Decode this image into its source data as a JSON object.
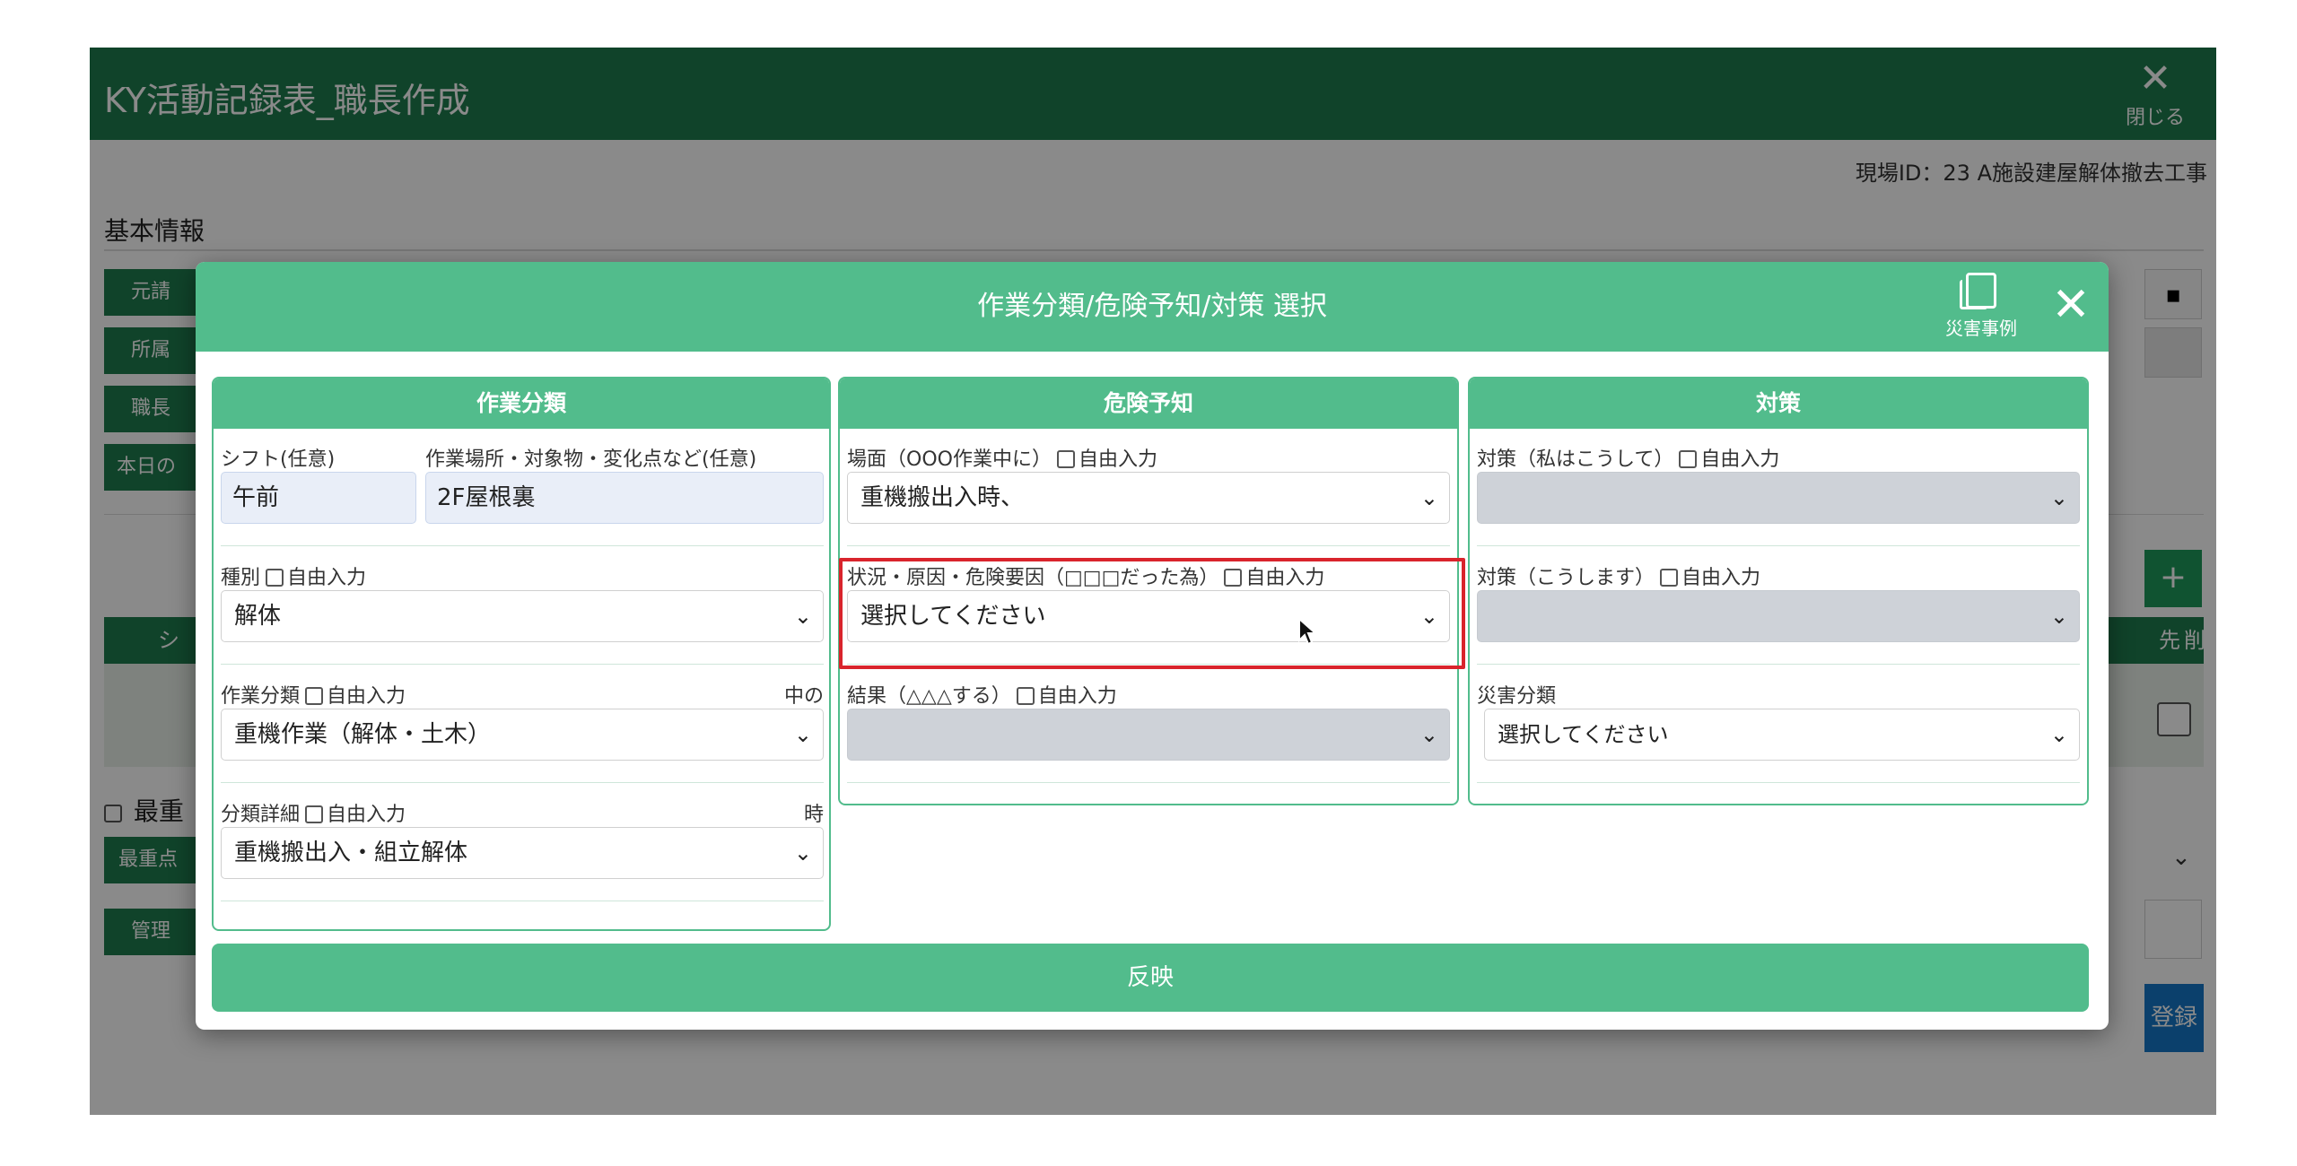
{
  "app": {
    "title": "KY活動記録表_職長作成",
    "close_label": "閉じる",
    "site_id": "現場ID：23 A施設建屋解体撤去工事",
    "section_title": "基本情報",
    "bg_labels": [
      "元請",
      "所属",
      "職長",
      "本日の"
    ],
    "table_head_first": "シ",
    "table_head_col_a": "先",
    "table_head_col_b": "削",
    "priority_label": "最重",
    "priority_field_label": "最重点",
    "manager_label": "管理",
    "register_label": "登録",
    "plus_label": "+"
  },
  "modal": {
    "title": "作業分類/危険予知/対策 選択",
    "disaster_cases_label": "災害事例",
    "close_glyph": "✕",
    "reflect_label": "反映",
    "columns": {
      "work": {
        "header": "作業分類",
        "shift_label": "シフト(任意)",
        "shift_value": "午前",
        "place_label": "作業場所・対象物・変化点など(任意)",
        "place_value": "2F屋根裏",
        "type_label": "種別",
        "type_value": "解体",
        "category_label": "作業分類",
        "category_value": "重機作業（解体・土木）",
        "category_note": "中の",
        "detail_label": "分類詳細",
        "detail_value": "重機搬出入・組立解体",
        "detail_note": "時",
        "free_input": "自由入力"
      },
      "hazard": {
        "header": "危険予知",
        "scene_label": "場面（OOO作業中に）",
        "scene_value": "重機搬出入時、",
        "cause_label": "状況・原因・危険要因（□□□だった為）",
        "cause_value": "選択してください",
        "result_label": "結果（△△△する）",
        "result_value": "",
        "free_input": "自由入力"
      },
      "measure": {
        "header": "対策",
        "measure1_label": "対策（私はこうして）",
        "measure1_value": "",
        "measure2_label": "対策（こうします）",
        "measure2_value": "",
        "disaster_label": "災害分類",
        "disaster_value": "選択してください",
        "free_input": "自由入力"
      }
    }
  },
  "colors": {
    "header_green": "#1e7d4f",
    "modal_green": "#52bc8c",
    "highlight_red": "#d9242c",
    "select_grey": "#ced2d8",
    "input_blue": "#e9eef8",
    "register_blue": "#1677c8"
  },
  "icons": {
    "close": "close-icon",
    "disaster_cases": "document-stack-icon",
    "dropdown": "chevron-down-icon",
    "calendar": "calendar-icon",
    "cursor": "mouse-pointer-icon"
  }
}
